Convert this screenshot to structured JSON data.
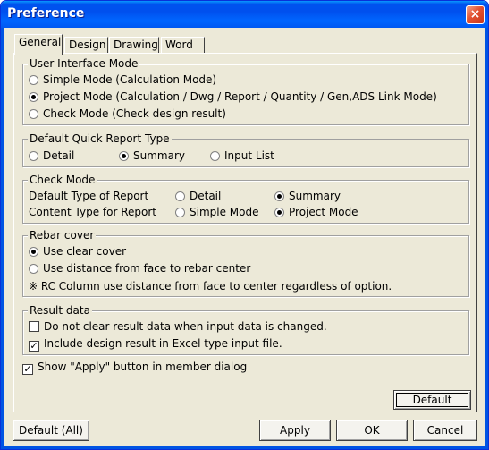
{
  "window": {
    "title": "Preference",
    "close_icon": "×"
  },
  "tabs": [
    {
      "label": "General",
      "active": true
    },
    {
      "label": "Design",
      "active": false
    },
    {
      "label": "Drawing",
      "active": false
    },
    {
      "label": "Word",
      "active": false
    }
  ],
  "ui_mode": {
    "legend": "User Interface Mode",
    "options": [
      {
        "label": "Simple Mode (Calculation Mode)",
        "selected": false
      },
      {
        "label": "Project Mode (Calculation / Dwg / Report / Quantity / Gen,ADS Link  Mode)",
        "selected": true
      },
      {
        "label": "Check Mode (Check design result)",
        "selected": false
      }
    ]
  },
  "quick_report": {
    "legend": "Default Quick Report Type",
    "options": [
      {
        "label": "Detail",
        "selected": false
      },
      {
        "label": "Summary",
        "selected": true
      },
      {
        "label": "Input List",
        "selected": false
      }
    ]
  },
  "check_mode": {
    "legend": "Check Mode",
    "report_type_label": "Default Type of Report",
    "report_type_options": [
      {
        "label": "Detail",
        "selected": false
      },
      {
        "label": "Summary",
        "selected": true
      }
    ],
    "content_type_label": "Content Type for Report",
    "content_type_options": [
      {
        "label": "Simple Mode",
        "selected": false
      },
      {
        "label": "Project Mode",
        "selected": true
      }
    ]
  },
  "rebar_cover": {
    "legend": "Rebar cover",
    "options": [
      {
        "label": "Use clear cover",
        "selected": true
      },
      {
        "label": "Use distance from face to rebar center",
        "selected": false
      }
    ],
    "note": "※ RC Column use distance from face to center regardless of option."
  },
  "result_data": {
    "legend": "Result data",
    "options": [
      {
        "label": "Do not clear result data when input data is changed.",
        "checked": false
      },
      {
        "label": "Include design result in Excel type input file.",
        "checked": true
      }
    ]
  },
  "apply_button_option": {
    "label": "Show \"Apply\" button in member dialog",
    "checked": true
  },
  "buttons": {
    "default": "Default",
    "default_all": "Default (All)",
    "apply": "Apply",
    "ok": "OK",
    "cancel": "Cancel"
  }
}
